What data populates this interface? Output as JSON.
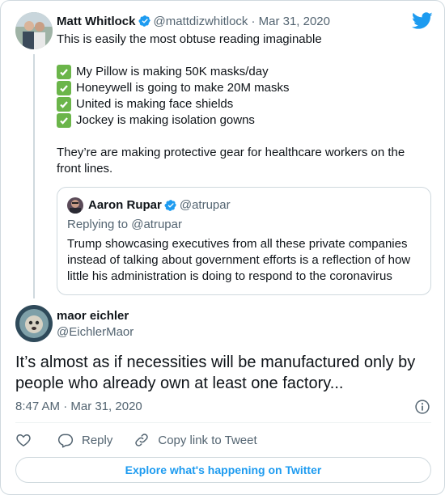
{
  "tweet": {
    "author_name": "Matt Whitlock",
    "author_handle": "@mattdizwhitlock",
    "date": "· Mar 31, 2020",
    "intro": "This is easily the most obtuse reading imaginable",
    "checklist": [
      "My Pillow is making 50K masks/day",
      "Honeywell is going to make 20M masks",
      "United is making face shields",
      "Jockey is making isolation gowns"
    ],
    "body": "They’re are making protective gear for healthcare workers on the front lines."
  },
  "quoted": {
    "author_name": "Aaron Rupar",
    "author_handle": "@atrupar",
    "replying_to": "Replying to @atrupar",
    "text": "Trump showcasing executives from all these private companies instead of talking about government efforts is a reflection of how little his administration is doing to respond to the coronavirus"
  },
  "reply": {
    "author_name": "maor eichler",
    "author_handle": "@EichlerMaor",
    "text": "It’s almost as if necessities will be manufactured only by people who already own at least one factory...",
    "timestamp": "8:47 AM · Mar 31, 2020"
  },
  "actions": {
    "reply_label": "Reply",
    "copy_link_label": "Copy link to Tweet"
  },
  "explore_label": "Explore what's happening on Twitter",
  "colors": {
    "accent": "#1d9bf0",
    "check_green": "#6bb54a",
    "secondary_text": "#536471",
    "border": "#cfd9de"
  },
  "icons": [
    "twitter-logo-icon",
    "verified-badge-icon",
    "check-mark-icon",
    "info-icon",
    "heart-icon",
    "reply-icon",
    "link-icon"
  ]
}
